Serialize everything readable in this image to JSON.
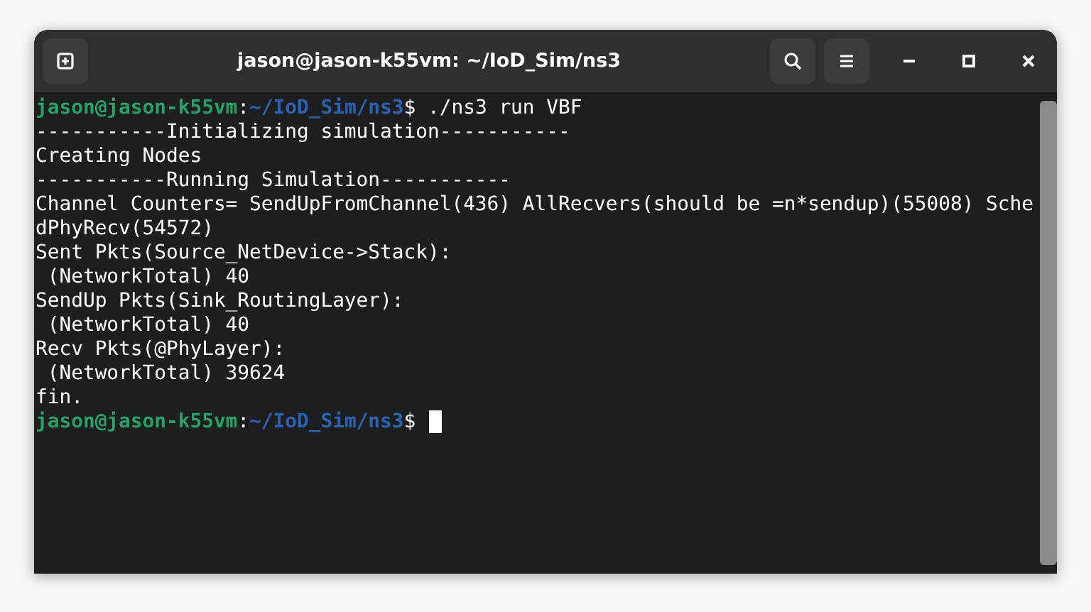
{
  "window": {
    "title": "jason@jason-k55vm: ~/IoD_Sim/ns3"
  },
  "terminal": {
    "lines": [
      {
        "kind": "prompt",
        "user": "jason@jason-k55vm",
        "colon": ":",
        "path": "~/IoD_Sim/ns3",
        "symbol": "$",
        "command": "./ns3 run VBF",
        "cursor": false
      },
      {
        "kind": "output",
        "text": "-----------Initializing simulation-----------"
      },
      {
        "kind": "output",
        "text": "Creating Nodes"
      },
      {
        "kind": "output",
        "text": "-----------Running Simulation-----------"
      },
      {
        "kind": "output",
        "text": "Channel Counters= SendUpFromChannel(436) AllRecvers(should be =n*sendup)(55008) Sche"
      },
      {
        "kind": "output",
        "text": "dPhyRecv(54572)"
      },
      {
        "kind": "output",
        "text": "Sent Pkts(Source_NetDevice->Stack):"
      },
      {
        "kind": "output",
        "text": " (NetworkTotal) 40"
      },
      {
        "kind": "output",
        "text": "SendUp Pkts(Sink_RoutingLayer):"
      },
      {
        "kind": "output",
        "text": " (NetworkTotal) 40"
      },
      {
        "kind": "output",
        "text": "Recv Pkts(@PhyLayer):"
      },
      {
        "kind": "output",
        "text": " (NetworkTotal) 39624"
      },
      {
        "kind": "output",
        "text": "fin."
      },
      {
        "kind": "prompt",
        "user": "jason@jason-k55vm",
        "colon": ":",
        "path": "~/IoD_Sim/ns3",
        "symbol": "$",
        "cursor": true
      }
    ]
  }
}
